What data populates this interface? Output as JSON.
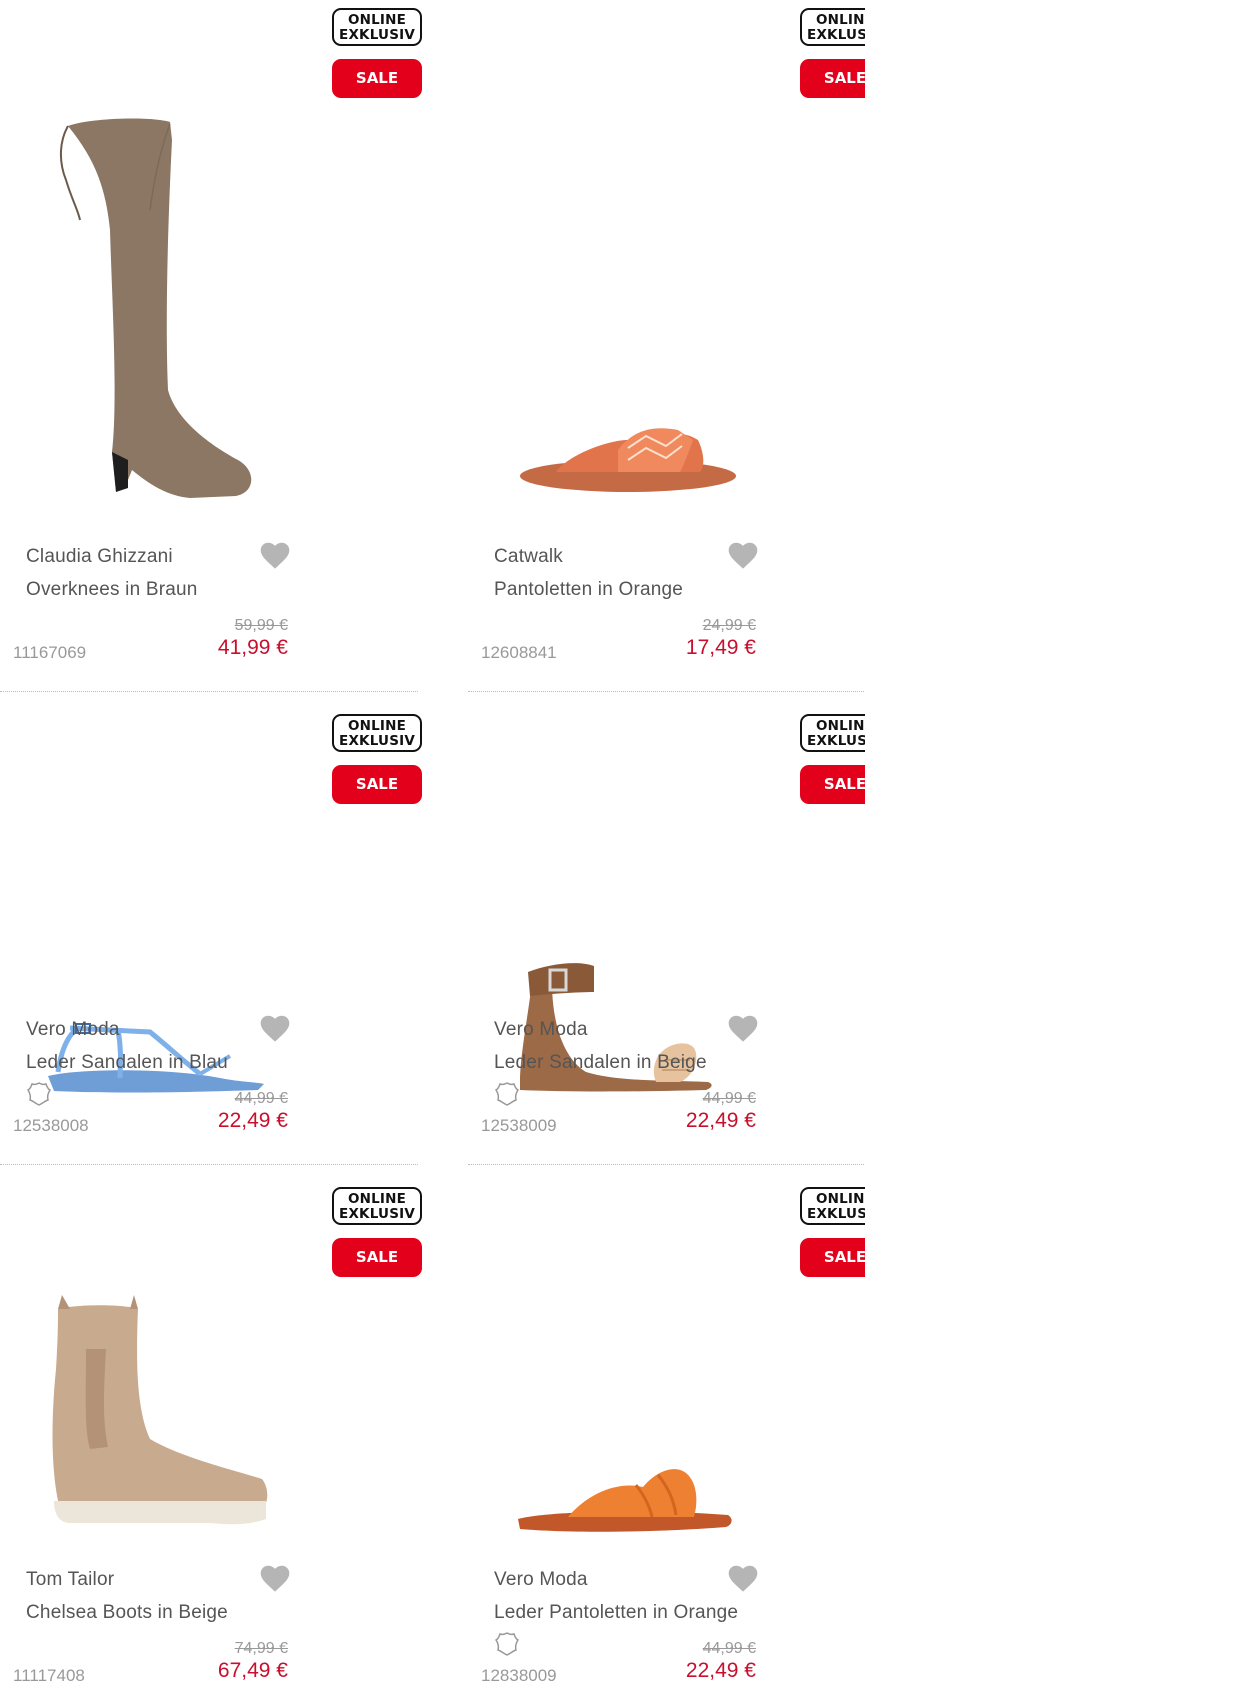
{
  "badges": {
    "online": "ONLINE\nEXKLUSIV",
    "sale": "SALE"
  },
  "colors": {
    "sale_red": "#e2001a",
    "price_red": "#c8102e"
  },
  "products": [
    {
      "brand": "Claudia Ghizzani",
      "title": "Overknees in Braun",
      "old_price": "59,99 €",
      "new_price": "41,99 €",
      "article": "11167069",
      "leather_icon": false,
      "image": "tall-boot-brown"
    },
    {
      "brand": "Catwalk",
      "title": "Pantoletten in Orange",
      "old_price": "24,99 €",
      "new_price": "17,49 €",
      "article": "12608841",
      "leather_icon": false,
      "image": "slide-orange-embroidered"
    },
    {
      "brand": "Vero Moda",
      "title": "Leder Sandalen in Blau",
      "old_price": "44,99 €",
      "new_price": "22,49 €",
      "article": "12538008",
      "leather_icon": true,
      "image": "sandal-blue"
    },
    {
      "brand": "Vero Moda",
      "title": "Leder Sandalen in Beige",
      "old_price": "44,99 €",
      "new_price": "22,49 €",
      "article": "12538009",
      "leather_icon": true,
      "image": "sandal-beige"
    },
    {
      "brand": "Tom Tailor",
      "title": "Chelsea Boots in Beige",
      "old_price": "74,99 €",
      "new_price": "67,49 €",
      "article": "11117408",
      "leather_icon": false,
      "image": "chelsea-boot-beige"
    },
    {
      "brand": "Vero Moda",
      "title": "Leder Pantoletten in Orange",
      "old_price": "44,99 €",
      "new_price": "22,49 €",
      "article": "12838009",
      "leather_icon": true,
      "image": "slide-orange-twist"
    }
  ]
}
